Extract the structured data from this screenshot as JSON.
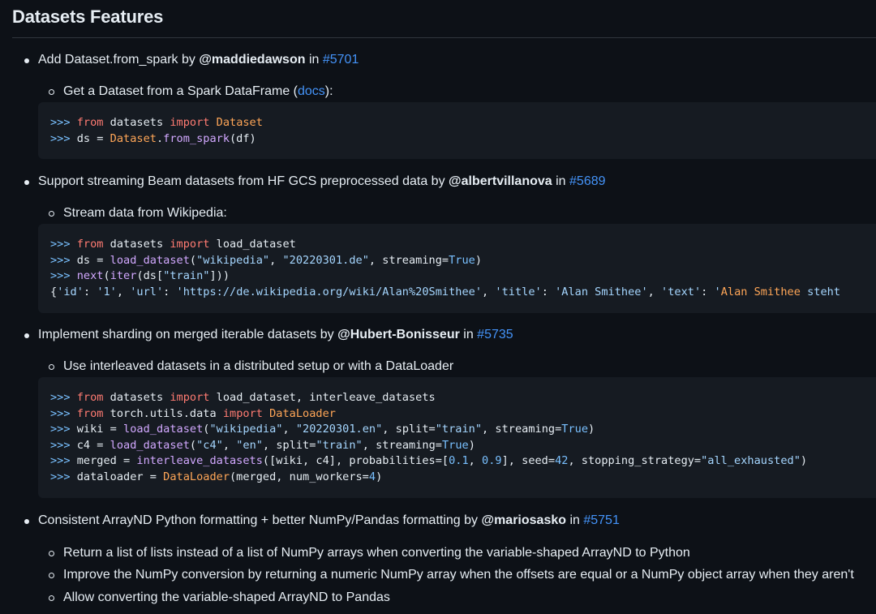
{
  "page": {
    "title": "Datasets Features"
  },
  "features": [
    {
      "text": "Add Dataset.from_spark by ",
      "user": "@maddiedawson",
      "in": " in ",
      "pr": "#5701",
      "sub_pre": "Get a Dataset from a Spark DataFrame (",
      "sub_link": "docs",
      "sub_post": "):",
      "code": [
        [
          [
            "p",
            ">>> "
          ],
          [
            "k",
            "from"
          ],
          [
            "",
            " datasets "
          ],
          [
            "k",
            "import"
          ],
          [
            "",
            " "
          ],
          [
            "c",
            "Dataset"
          ]
        ],
        [
          [
            "p",
            ">>> "
          ],
          [
            "",
            "ds = "
          ],
          [
            "c",
            "Dataset"
          ],
          [
            "",
            "."
          ],
          [
            "f",
            "from_spark"
          ],
          [
            "",
            "(df)"
          ]
        ]
      ]
    },
    {
      "text": "Support streaming Beam datasets from HF GCS preprocessed data by ",
      "user": "@albertvillanova",
      "in": " in ",
      "pr": "#5689",
      "sub": "Stream data from Wikipedia:",
      "code": [
        [
          [
            "p",
            ">>> "
          ],
          [
            "k",
            "from"
          ],
          [
            "",
            " datasets "
          ],
          [
            "k",
            "import"
          ],
          [
            "",
            " load_dataset"
          ]
        ],
        [
          [
            "p",
            ">>> "
          ],
          [
            "",
            "ds = "
          ],
          [
            "f",
            "load_dataset"
          ],
          [
            "",
            "("
          ],
          [
            "s",
            "\"wikipedia\""
          ],
          [
            "",
            ", "
          ],
          [
            "s",
            "\"20220301.de\""
          ],
          [
            "",
            ", streaming="
          ],
          [
            "p",
            "True"
          ],
          [
            "",
            ")"
          ]
        ],
        [
          [
            "p",
            ">>> "
          ],
          [
            "f",
            "next"
          ],
          [
            "",
            "("
          ],
          [
            "f",
            "iter"
          ],
          [
            "",
            "(ds["
          ],
          [
            "s",
            "\"train\""
          ],
          [
            "",
            "]))"
          ]
        ],
        [
          [
            "",
            "{"
          ],
          [
            "s",
            "'id'"
          ],
          [
            "",
            ": "
          ],
          [
            "s",
            "'1'"
          ],
          [
            "",
            ", "
          ],
          [
            "s",
            "'url'"
          ],
          [
            "",
            ": "
          ],
          [
            "s",
            "'https://de.wikipedia.org/wiki/Alan%20Smithee'"
          ],
          [
            "",
            ", "
          ],
          [
            "s",
            "'title'"
          ],
          [
            "",
            ": "
          ],
          [
            "s",
            "'Alan Smithee'"
          ],
          [
            "",
            ", "
          ],
          [
            "s",
            "'text'"
          ],
          [
            "",
            ": "
          ],
          [
            "s",
            "'"
          ],
          [
            "c",
            "Alan Smithee"
          ],
          [
            "s",
            " steht"
          ]
        ]
      ]
    },
    {
      "text": "Implement sharding on merged iterable datasets by ",
      "user": "@Hubert-Bonisseur",
      "in": " in ",
      "pr": "#5735",
      "sub": "Use interleaved datasets in a distributed setup or with a DataLoader",
      "code": [
        [
          [
            "p",
            ">>> "
          ],
          [
            "k",
            "from"
          ],
          [
            "",
            " datasets "
          ],
          [
            "k",
            "import"
          ],
          [
            "",
            " load_dataset, interleave_datasets"
          ]
        ],
        [
          [
            "p",
            ">>> "
          ],
          [
            "k",
            "from"
          ],
          [
            "",
            " torch.utils.data "
          ],
          [
            "k",
            "import"
          ],
          [
            "",
            " "
          ],
          [
            "c",
            "DataLoader"
          ]
        ],
        [
          [
            "p",
            ">>> "
          ],
          [
            "",
            "wiki = "
          ],
          [
            "f",
            "load_dataset"
          ],
          [
            "",
            "("
          ],
          [
            "s",
            "\"wikipedia\""
          ],
          [
            "",
            ", "
          ],
          [
            "s",
            "\"20220301.en\""
          ],
          [
            "",
            ", split="
          ],
          [
            "s",
            "\"train\""
          ],
          [
            "",
            ", streaming="
          ],
          [
            "p",
            "True"
          ],
          [
            "",
            ")"
          ]
        ],
        [
          [
            "p",
            ">>> "
          ],
          [
            "",
            "c4 = "
          ],
          [
            "f",
            "load_dataset"
          ],
          [
            "",
            "("
          ],
          [
            "s",
            "\"c4\""
          ],
          [
            "",
            ", "
          ],
          [
            "s",
            "\"en\""
          ],
          [
            "",
            ", split="
          ],
          [
            "s",
            "\"train\""
          ],
          [
            "",
            ", streaming="
          ],
          [
            "p",
            "True"
          ],
          [
            "",
            ")"
          ]
        ],
        [
          [
            "p",
            ">>> "
          ],
          [
            "",
            "merged = "
          ],
          [
            "f",
            "interleave_datasets"
          ],
          [
            "",
            "([wiki, c4], probabilities=["
          ],
          [
            "p",
            "0.1"
          ],
          [
            "",
            ", "
          ],
          [
            "p",
            "0.9"
          ],
          [
            "",
            "], seed="
          ],
          [
            "p",
            "42"
          ],
          [
            "",
            ", stopping_strategy="
          ],
          [
            "s",
            "\"all_exhausted\""
          ],
          [
            "",
            ")"
          ]
        ],
        [
          [
            "p",
            ">>> "
          ],
          [
            "",
            "dataloader = "
          ],
          [
            "c",
            "DataLoader"
          ],
          [
            "",
            "(merged, num_workers="
          ],
          [
            "p",
            "4"
          ],
          [
            "",
            ")"
          ]
        ]
      ]
    },
    {
      "text": "Consistent ArrayND Python formatting + better NumPy/Pandas formatting by ",
      "user": "@mariosasko",
      "in": " in ",
      "pr": "#5751",
      "subs": [
        "Return a list of lists instead of a list of NumPy arrays when converting the variable-shaped ArrayND to Python",
        "Improve the NumPy conversion by returning a numeric NumPy array when the offsets are equal or a NumPy object array when they aren't",
        "Allow converting the variable-shaped ArrayND to Pandas"
      ]
    }
  ]
}
